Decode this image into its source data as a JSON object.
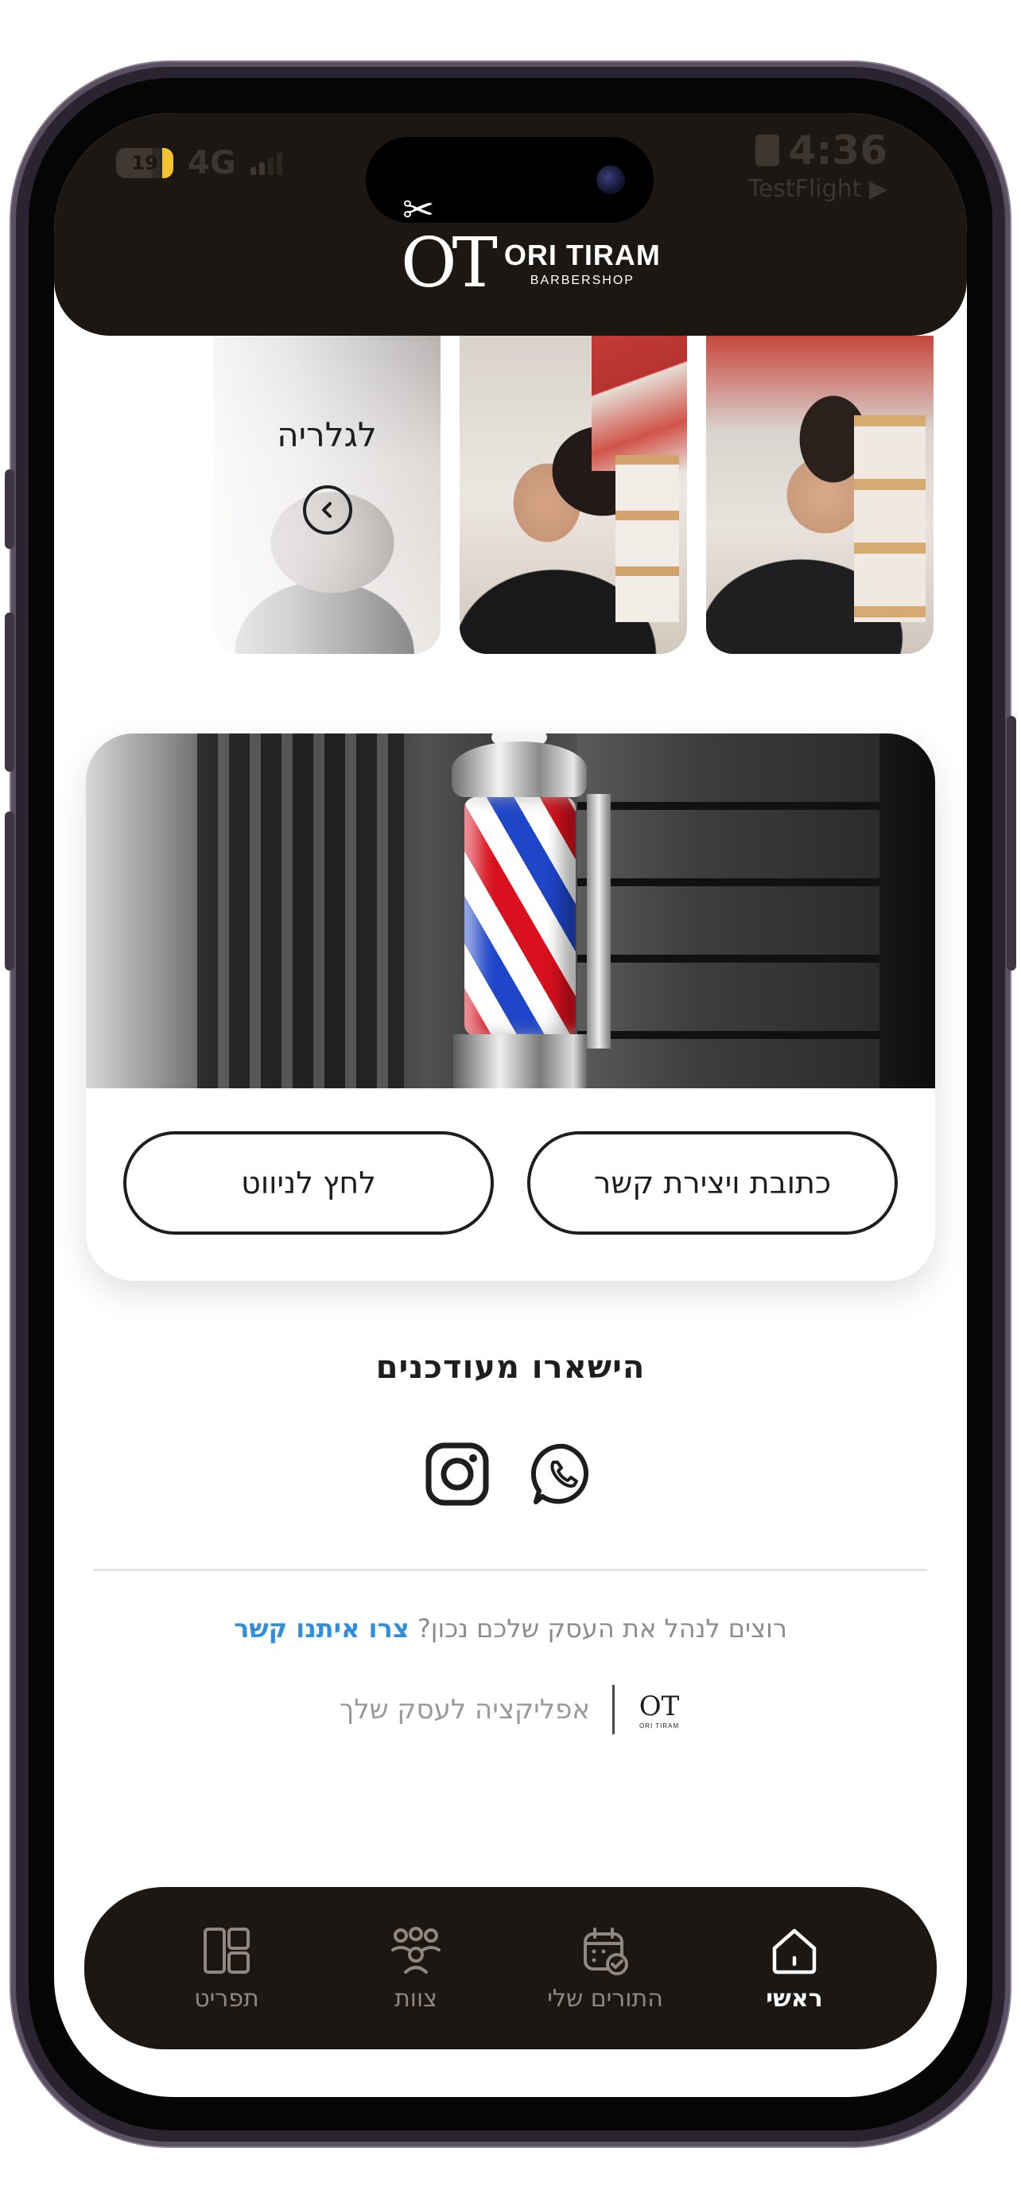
{
  "status_bar": {
    "battery": "19",
    "network": "4G",
    "time": "4:36",
    "back_app": "TestFlight ▶"
  },
  "header": {
    "logo_mark": "OT",
    "brand_name": "ORI TIRAM",
    "brand_sub": "BARBERSHOP"
  },
  "gallery": {
    "label": "לגלריה",
    "arrow_glyph": "‹"
  },
  "info_card": {
    "address_button": "כתובת ויצירת קשר",
    "navigate_button": "לחץ לניווט"
  },
  "social": {
    "title": "הישארו מעודכנים",
    "icons": [
      "whatsapp-icon",
      "instagram-icon"
    ]
  },
  "footer": {
    "promo_text": "רוצים לנהל את העסק שלכם נכון?",
    "promo_link": "צרו איתנו קשר",
    "powered_text": "אפליקציה לעסק שלך",
    "powered_logo": "OT",
    "powered_logo_sub": "ORI TIRAM"
  },
  "bottom_nav": {
    "items": [
      {
        "label": "ראשי",
        "icon": "home-icon",
        "active": true
      },
      {
        "label": "התורים שלי",
        "icon": "calendar-check-icon",
        "active": false
      },
      {
        "label": "צוות",
        "icon": "team-icon",
        "active": false
      },
      {
        "label": "תפריט",
        "icon": "menu-grid-icon",
        "active": false
      }
    ]
  },
  "colors": {
    "header_bg": "#1c1713",
    "link_blue": "#2f8fdc",
    "nav_active": "#ffffff",
    "nav_inactive": "#8f8780"
  }
}
